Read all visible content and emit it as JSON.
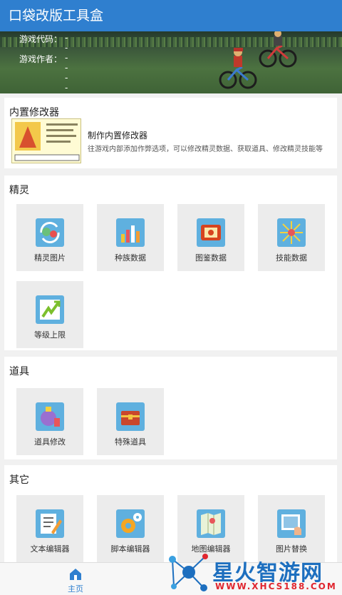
{
  "app_bar": {
    "title": "口袋改版工具盒"
  },
  "banner": {
    "game_code_label": "游戏代码：",
    "game_code_value": "-----",
    "game_author_label": "游戏作者：",
    "game_author_value": "-----"
  },
  "builtin_modifier": {
    "section_title": "内置修改器",
    "item_title": "制作内置修改器",
    "item_desc": "往游戏内部添加作弊选项，可以修改精灵数据、获取道具、修改精灵技能等"
  },
  "pokemon": {
    "section_title": "精灵",
    "tiles": [
      {
        "label": "精灵图片",
        "icon": "pokemon-image-icon"
      },
      {
        "label": "种族数据",
        "icon": "bar-chart-icon"
      },
      {
        "label": "图鉴数据",
        "icon": "pokedex-icon"
      },
      {
        "label": "技能数据",
        "icon": "sparkle-burst-icon"
      },
      {
        "label": "等级上限",
        "icon": "level-up-arrow-icon"
      }
    ]
  },
  "items": {
    "section_title": "道具",
    "tiles": [
      {
        "label": "道具修改",
        "icon": "potion-bag-icon"
      },
      {
        "label": "特殊道具",
        "icon": "treasure-chest-icon"
      }
    ]
  },
  "other": {
    "section_title": "其它",
    "tiles": [
      {
        "label": "文本编辑器",
        "icon": "text-edit-icon"
      },
      {
        "label": "脚本编辑器",
        "icon": "gears-icon"
      },
      {
        "label": "地图编辑器",
        "icon": "map-icon"
      },
      {
        "label": "图片替换",
        "icon": "image-replace-icon"
      }
    ]
  },
  "bottom_nav": {
    "home_label": "主页"
  },
  "watermark": {
    "text": "星火智游网",
    "url": "WWW.XHCS188.COM"
  }
}
